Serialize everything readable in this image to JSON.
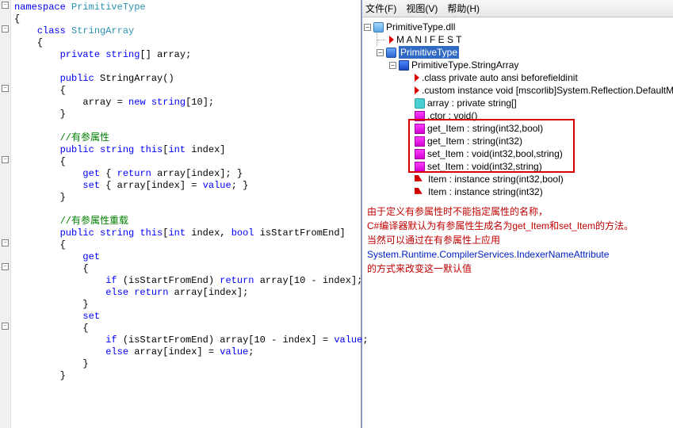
{
  "code": {
    "namespace_kw": "namespace",
    "namespace_name": "PrimitiveType",
    "class_kw": "class",
    "class_name": "StringArray",
    "private_kw": "private",
    "string_kw": "string",
    "array_field": "array",
    "public_kw": "public",
    "ctor_name": "StringArray",
    "ctor_body_new": "new",
    "ctor_body_string": "string",
    "ctor_body_size": "10",
    "comment1": "//有参属性",
    "this_kw": "this",
    "int_kw": "int",
    "index_param": "index",
    "get_kw": "get",
    "set_kw": "set",
    "return_kw": "return",
    "value_kw": "value",
    "comment2": "//有参属性重载",
    "bool_kw": "bool",
    "param2": "isStartFromEnd",
    "if_kw": "if",
    "else_kw": "else",
    "ten": "10"
  },
  "menu": {
    "file": "文件(F)",
    "view": "视图(V)",
    "help": "帮助(H)"
  },
  "tree": {
    "root": "PrimitiveType.dll",
    "manifest": "M A N I F E S T",
    "ns": "PrimitiveType",
    "cls": "PrimitiveType.StringArray",
    "attr1": ".class private auto ansi beforefieldinit",
    "attr2": ".custom instance void [mscorlib]System.Reflection.DefaultM",
    "field": "array : private string[]",
    "ctor": ".ctor : void()",
    "m1": "get_Item : string(int32,bool)",
    "m2": "get_Item : string(int32)",
    "m3": "set_Item : void(int32,bool,string)",
    "m4": "set_Item : void(int32,string)",
    "p1": "Item : instance string(int32,bool)",
    "p2": "Item : instance string(int32)"
  },
  "explain": {
    "l1": "由于定义有参属性时不能指定属性的名称，",
    "l2": "C#编译器默认为有参属性生成名为get_Item和set_Item的方法。",
    "l3": "当然可以通过在有参属性上应用",
    "l4": "System.Runtime.CompilerServices.IndexerNameAttribute",
    "l5": "的方式来改变这一默认值"
  }
}
